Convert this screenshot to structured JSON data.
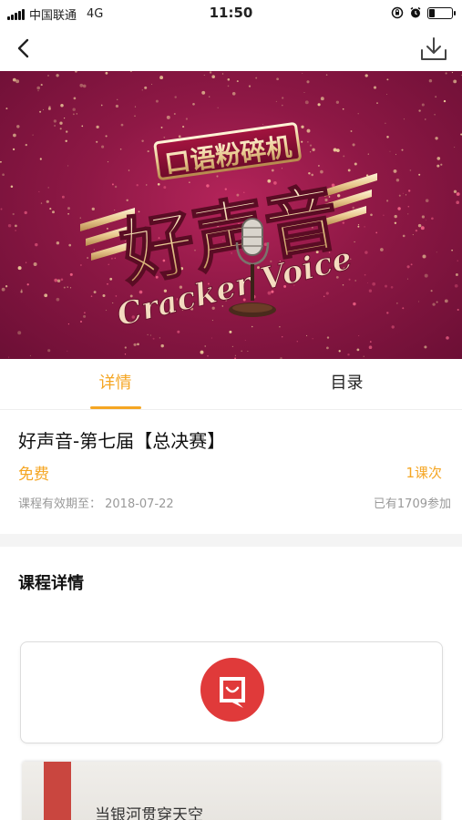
{
  "status_bar": {
    "carrier": "中国联通",
    "network": "4G",
    "time": "11:50",
    "icons": [
      "signal-icon",
      "lock-rotation-icon",
      "alarm-icon",
      "battery-icon"
    ],
    "battery_level": 0.25
  },
  "nav": {
    "back_icon": "chevron-left-icon",
    "download_icon": "download-icon"
  },
  "banner": {
    "top_text": "口语粉碎机",
    "main_text": "好声音",
    "sub_text": "Cracker Voice"
  },
  "tabs": [
    {
      "label": "详情",
      "active": true
    },
    {
      "label": "目录",
      "active": false
    }
  ],
  "course": {
    "title": "好声音-第七届【总决赛】",
    "price": "免费",
    "lessons": "1课次",
    "expiry": "课程有效期至：  2018-07-22",
    "participants": "已有1709参加"
  },
  "detail": {
    "heading": "课程详情",
    "paper_text": "当银河贯穿天空"
  },
  "colors": {
    "accent": "#f5a623",
    "banner_base": "#8e1845",
    "logo_red": "#e03a3a"
  }
}
